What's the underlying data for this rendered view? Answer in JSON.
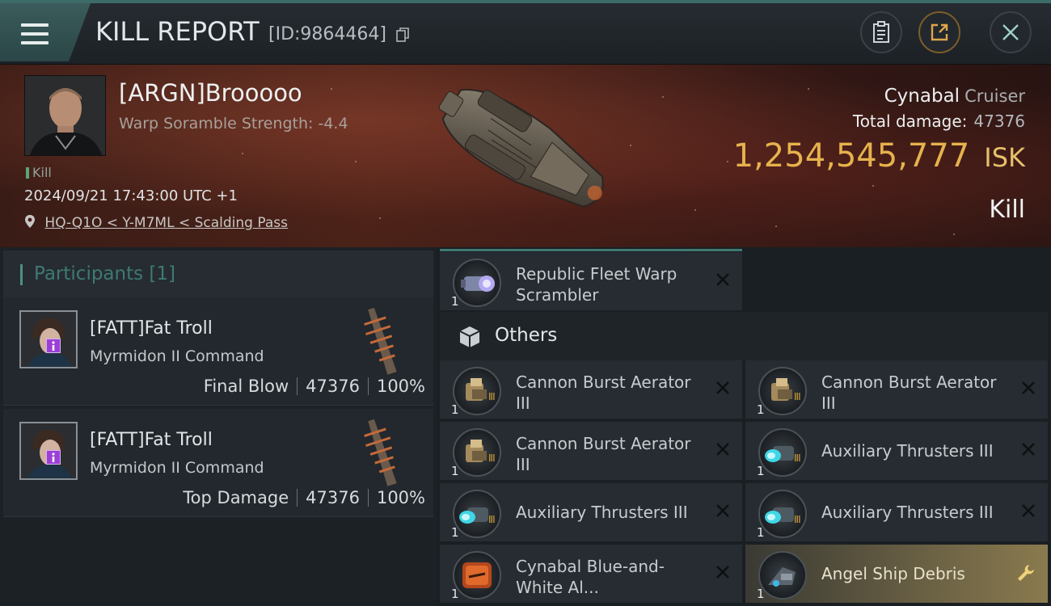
{
  "header": {
    "title": "KILL REPORT",
    "report_id": "[ID:9864464]",
    "icons": [
      "menu-icon",
      "copy-icon",
      "clipboard-icon",
      "share-icon",
      "close-icon"
    ]
  },
  "victim": {
    "name": "[ARGN]Brooooo",
    "scramble": "Warp Soramble Strength: -4.4",
    "tag": "Kill",
    "timestamp": "2024/09/21 17:43:00 UTC +1",
    "location": "HQ-Q1O < Y-M7ML < Scalding Pass",
    "ship": "Cynabal",
    "ship_class": "Cruiser",
    "total_damage_label": "Total damage:",
    "total_damage": "47376",
    "isk_value": "1,254,545,777",
    "isk_unit": "ISK",
    "result": "Kill"
  },
  "participants": {
    "title": "Participants [1]",
    "list": [
      {
        "name": "[FATT]Fat Troll",
        "ship": "Myrmidon II Command",
        "role": "Final Blow",
        "damage": "47376",
        "percent": "100%"
      },
      {
        "name": "[FATT]Fat Troll",
        "ship": "Myrmidon II Command",
        "role": "Top Damage",
        "damage": "47376",
        "percent": "100%"
      }
    ]
  },
  "items": {
    "top": {
      "qty": "1",
      "name": "Republic Fleet Warp Scrambler"
    },
    "others_label": "Others",
    "list": [
      {
        "qty": "1",
        "name": "Cannon Burst Aerator III"
      },
      {
        "qty": "1",
        "name": "Cannon Burst Aerator III"
      },
      {
        "qty": "1",
        "name": "Cannon Burst Aerator III"
      },
      {
        "qty": "1",
        "name": "Auxiliary Thrusters III"
      },
      {
        "qty": "1",
        "name": "Auxiliary Thrusters III"
      },
      {
        "qty": "1",
        "name": "Auxiliary Thrusters III"
      },
      {
        "qty": "1",
        "name": "Cynabal Blue-and-White Al..."
      },
      {
        "qty": "1",
        "name": "Angel Ship Debris"
      }
    ]
  },
  "colors": {
    "accent": "#3f7a72",
    "isk": "#e6b24d",
    "badge": "#9b3fd6"
  }
}
